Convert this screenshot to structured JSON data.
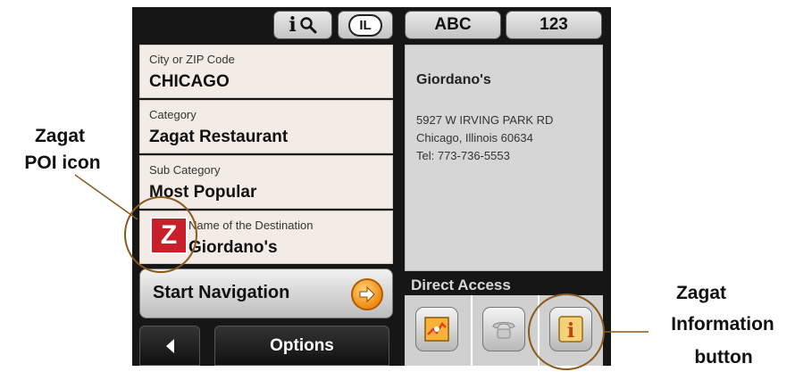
{
  "toolbar": {
    "info_search_label": "i",
    "state_label": "IL",
    "abc_label": "ABC",
    "num_label": "123"
  },
  "fields": [
    {
      "label": "City or ZIP Code",
      "value": "CHICAGO"
    },
    {
      "label": "Category",
      "value": "Zagat Restaurant"
    },
    {
      "label": "Sub Category",
      "value": "Most Popular"
    },
    {
      "label": "Name of the Destination",
      "value": "Giordano's"
    }
  ],
  "zagat_icon_letter": "Z",
  "start_navigation": "Start Navigation",
  "options": "Options",
  "info": {
    "name": "Giordano's",
    "address": "5927 W IRVING PARK RD",
    "city": "Chicago, Illinois 60634",
    "phone": "Tel: 773-736-5553"
  },
  "direct_access": "Direct Access",
  "direct_access_info_label": "i",
  "annotations": {
    "left_1": "Zagat",
    "left_2": "POI icon",
    "right_1": "Zagat",
    "right_2": "Information",
    "right_3": "button"
  },
  "colors": {
    "zagat_red": "#c8202a",
    "accent_orange": "#f08a12",
    "annotation_circle": "#8a5a1c"
  }
}
